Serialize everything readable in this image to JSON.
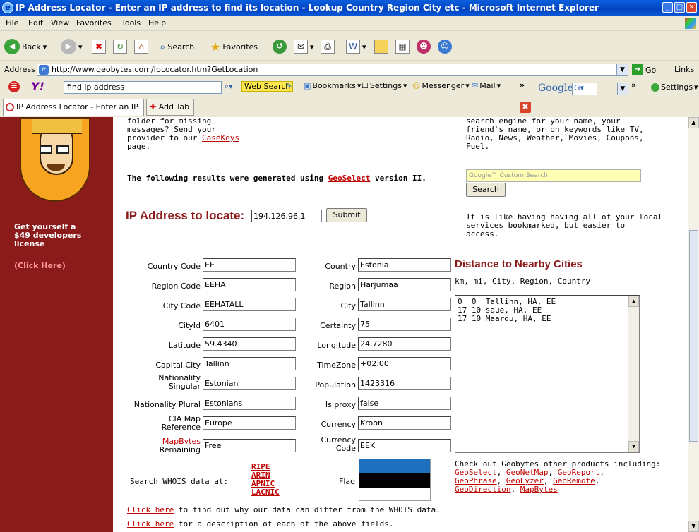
{
  "window": {
    "title": "IP Address Locator - Enter an IP address to find its location - Lookup Country Region City etc - Microsoft Internet Explorer"
  },
  "menu": [
    "File",
    "Edit",
    "View",
    "Favorites",
    "Tools",
    "Help"
  ],
  "toolbar": {
    "back": "Back",
    "search": "Search",
    "favorites": "Favorites"
  },
  "address": {
    "label": "Address",
    "url": "http://www.geobytes.com/IpLocator.htm?GetLocation",
    "go": "Go",
    "links": "Links"
  },
  "yahoo": {
    "search_value": "find ip address",
    "web_search": "Web Search",
    "bookmarks": "Bookmarks",
    "settings": "Settings",
    "messenger": "Messenger",
    "mail": "Mail",
    "google_settings": "Settings"
  },
  "tabs": {
    "tab1": "IP Address Locator - Enter an IP...",
    "add_tab": "Add Tab"
  },
  "sidebar": {
    "license_text": "Get yourself a $49 developers license",
    "click_here": "(Click Here)"
  },
  "top_left_text": {
    "line1": "folder for missing",
    "line2": "messages? Send your",
    "line3": "provider to our",
    "link": "CaseKeys",
    "line4": "page."
  },
  "top_right_text": {
    "line1": "search engine for your name, your",
    "line2": "friend's name, or on keywords like TV,",
    "line3": "Radio, News, Weather, Movies, Coupons,",
    "line4": "Fuel."
  },
  "results_note": {
    "prefix": "The following results were generated using ",
    "link": "GeoSelect",
    "suffix": " version II."
  },
  "google_box": {
    "placeholder": "Google™ Custom Search",
    "button": "Search"
  },
  "locate": {
    "label": "IP Address to locate:",
    "value": "194.126.96.1",
    "submit": "Submit"
  },
  "bookmarked_text": {
    "line1": "It is like having having all of your local",
    "line2": "services bookmarked, but easier to",
    "line3": "access."
  },
  "left_fields": [
    {
      "label": "Country Code",
      "value": "EE"
    },
    {
      "label": "Region Code",
      "value": "EEHA"
    },
    {
      "label": "City Code",
      "value": "EEHATALL"
    },
    {
      "label": "CityId",
      "value": "6401"
    },
    {
      "label": "Latitude",
      "value": "59.4340"
    },
    {
      "label": "Capital City",
      "value": "Tallinn"
    },
    {
      "label": "Nationality Singular",
      "value": "Estonian"
    },
    {
      "label": "Nationality Plural",
      "value": "Estonians"
    },
    {
      "label": "CIA Map Reference",
      "value": "Europe"
    },
    {
      "label": "MapBytes Remaining",
      "value": "Free"
    }
  ],
  "right_fields": [
    {
      "label": "Country",
      "value": "Estonia"
    },
    {
      "label": "Region",
      "value": "Harjumaa"
    },
    {
      "label": "City",
      "value": "Tallinn"
    },
    {
      "label": "Certainty",
      "value": "75"
    },
    {
      "label": "Longitude",
      "value": "24.7280"
    },
    {
      "label": "TimeZone",
      "value": "+02:00"
    },
    {
      "label": "Population",
      "value": "1423316"
    },
    {
      "label": "Is proxy",
      "value": "false"
    },
    {
      "label": "Currency",
      "value": "Kroon"
    },
    {
      "label": "Currency Code",
      "value": "EEK"
    }
  ],
  "distance": {
    "title": "Distance to Nearby Cities",
    "header": "km, mi, City, Region, Country",
    "rows": [
      "0  0  Tallinn, HA, EE",
      "17 10 saue, HA, EE",
      "17 10 Maardu, HA, EE"
    ]
  },
  "whois": {
    "label": "Search WHOIS data at:",
    "links": [
      "RIPE",
      "ARIN",
      "APNIC",
      "LACNIC"
    ]
  },
  "flag": {
    "label": "Flag",
    "colors": [
      "#1f6fbf",
      "#000000",
      "#ffffff"
    ]
  },
  "products": {
    "text": "Check out Geobytes other products including:",
    "links": [
      "GeoSelect",
      "GeoNetMap",
      "GeoReport",
      "GeoPhrase",
      "GeoLyzer",
      "GeoRemote",
      "GeoDirection",
      "MapBytes"
    ]
  },
  "footer": {
    "link1": "Click here",
    "text1": " to find out why our data can differ from the WHOIS data.",
    "link2": "Click here",
    "text2": " for a description of each of the above fields."
  }
}
